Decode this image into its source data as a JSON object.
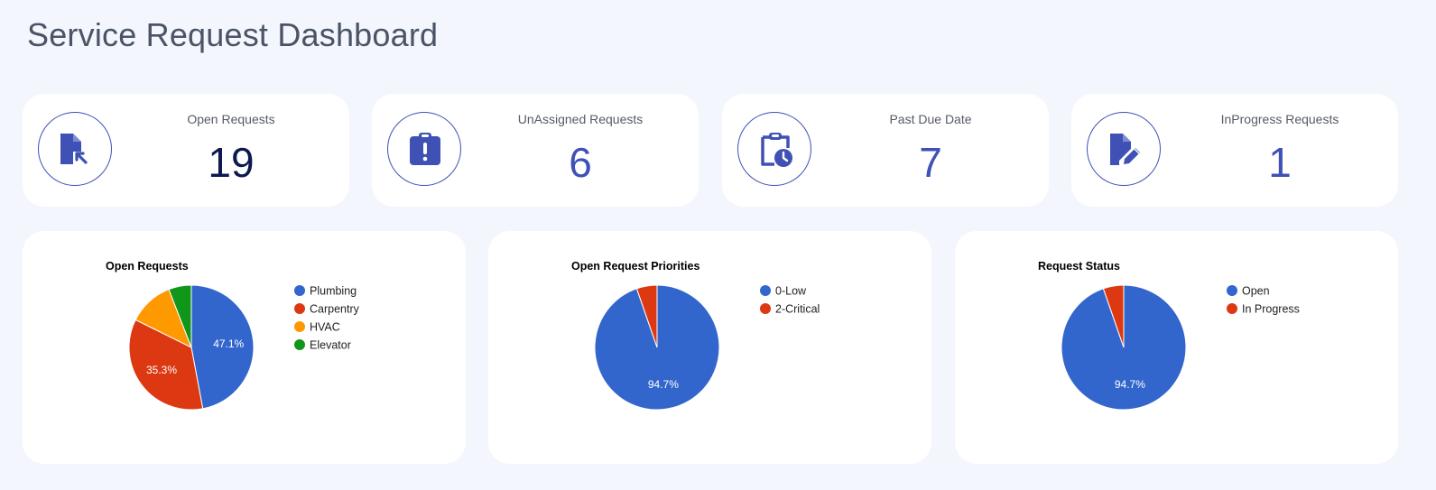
{
  "page": {
    "title": "Service Request Dashboard"
  },
  "stats": [
    {
      "label": "Open Requests",
      "value": "19",
      "icon": "file-import-icon"
    },
    {
      "label": "UnAssigned Requests",
      "value": "6",
      "icon": "clipboard-exclamation-icon"
    },
    {
      "label": "Past Due Date",
      "value": "7",
      "icon": "clipboard-clock-icon"
    },
    {
      "label": "InProgress Requests",
      "value": "1",
      "icon": "file-edit-icon"
    }
  ],
  "colors": {
    "accent": "#3f51b5",
    "accent_dark": "#0d1a4f",
    "background": "#f3f6fd",
    "card": "#ffffff",
    "blue": "#3366cc",
    "red": "#dc3912",
    "orange": "#ff9900",
    "green": "#109618"
  },
  "chart_data": [
    {
      "type": "pie",
      "title": "Open Requests",
      "legend_position": "right",
      "slices": [
        {
          "name": "Plumbing",
          "value": 47.1,
          "color": "#3366cc",
          "label": "47.1%"
        },
        {
          "name": "Carpentry",
          "value": 35.3,
          "color": "#dc3912",
          "label": "35.3%"
        },
        {
          "name": "HVAC",
          "value": 11.8,
          "color": "#ff9900",
          "label": ""
        },
        {
          "name": "Elevator",
          "value": 5.9,
          "color": "#109618",
          "label": ""
        }
      ]
    },
    {
      "type": "pie",
      "title": "Open Request Priorities",
      "legend_position": "right",
      "slices": [
        {
          "name": "0-Low",
          "value": 94.7,
          "color": "#3366cc",
          "label": "94.7%"
        },
        {
          "name": "2-Critical",
          "value": 5.3,
          "color": "#dc3912",
          "label": ""
        }
      ]
    },
    {
      "type": "pie",
      "title": "Request Status",
      "legend_position": "right",
      "slices": [
        {
          "name": "Open",
          "value": 94.7,
          "color": "#3366cc",
          "label": "94.7%"
        },
        {
          "name": "In Progress",
          "value": 5.3,
          "color": "#dc3912",
          "label": ""
        }
      ]
    }
  ]
}
